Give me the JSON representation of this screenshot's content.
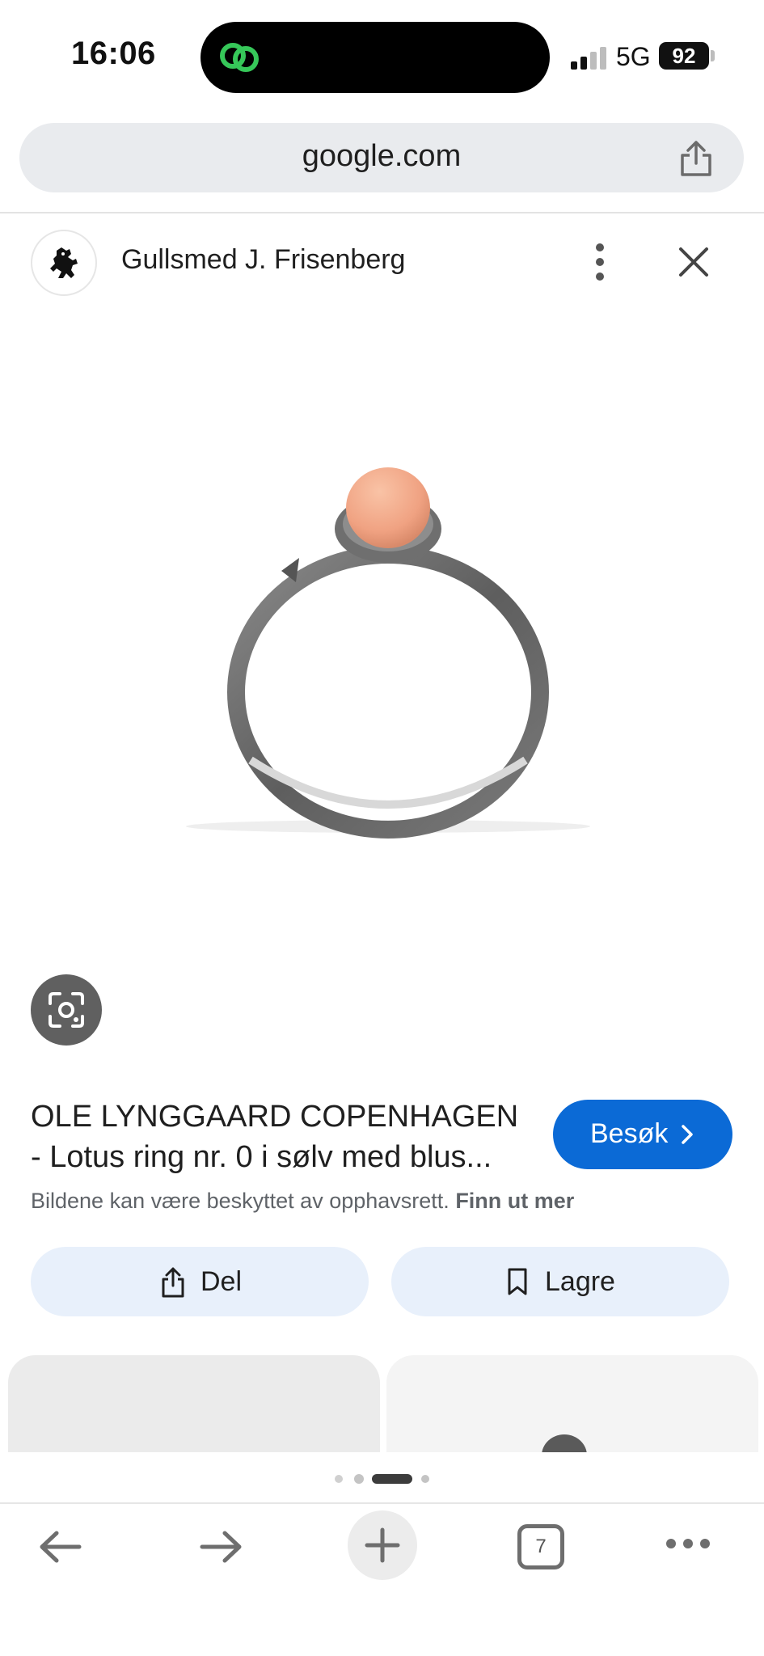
{
  "status_bar": {
    "time": "16:06",
    "network": "5G",
    "battery": "92"
  },
  "url_bar": {
    "url": "google.com"
  },
  "source": {
    "name": "Gullsmed J. Frisenberg"
  },
  "result": {
    "title": "OLE LYNGGAARD COPENHAGEN - Lotus ring nr. 0 i sølv med blus...",
    "visit_label": "Besøk",
    "copyright_text": "Bildene kan være beskyttet av opphavsrett.",
    "copyright_link": "Finn ut mer"
  },
  "actions": {
    "share_label": "Del",
    "save_label": "Lagre"
  },
  "toolbar": {
    "tab_count": "7"
  },
  "colors": {
    "accent": "#0b6ad6",
    "action_bg": "#e8f0fb",
    "gem": "#f2a989",
    "ring": "#6b6b6b"
  }
}
